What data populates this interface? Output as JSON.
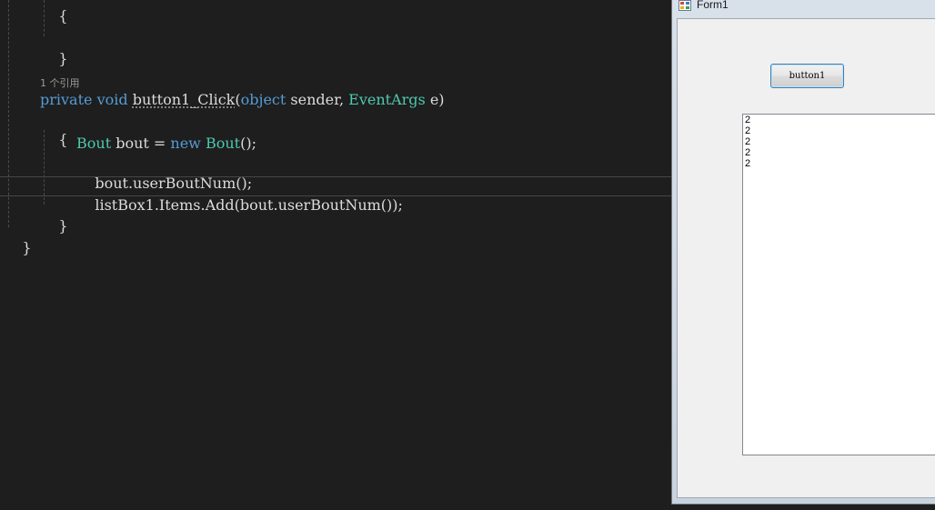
{
  "editor": {
    "codelens": "1 个引用",
    "lines": {
      "top_brace": "{",
      "close_brace_1": "}",
      "sig_private": "private",
      "sig_void": "void",
      "sig_name": "button1_Click",
      "sig_paren": "(",
      "sig_object": "object",
      "sig_sender": " sender, ",
      "sig_eventargs": "EventArgs",
      "sig_e": " e)",
      "open_brace": "{",
      "l1_type": "Bout",
      "l1_mid": " bout = ",
      "l1_new": "new",
      "l1_space": " ",
      "l1_type2": "Bout",
      "l1_end": "();",
      "l2": "bout.userBoutNum();",
      "l3": "listBox1.Items.Add(bout.userBoutNum());",
      "close_brace_2": "}",
      "close_brace_3": "}"
    },
    "colors": {
      "background": "#1e1e1e",
      "keyword": "#569cd6",
      "type": "#4ec9b0",
      "text": "#dcdcdc"
    }
  },
  "form": {
    "title": "Form1",
    "button_label": "button1",
    "listbox_items": [
      "2",
      "2",
      "2",
      "2",
      "2"
    ]
  }
}
